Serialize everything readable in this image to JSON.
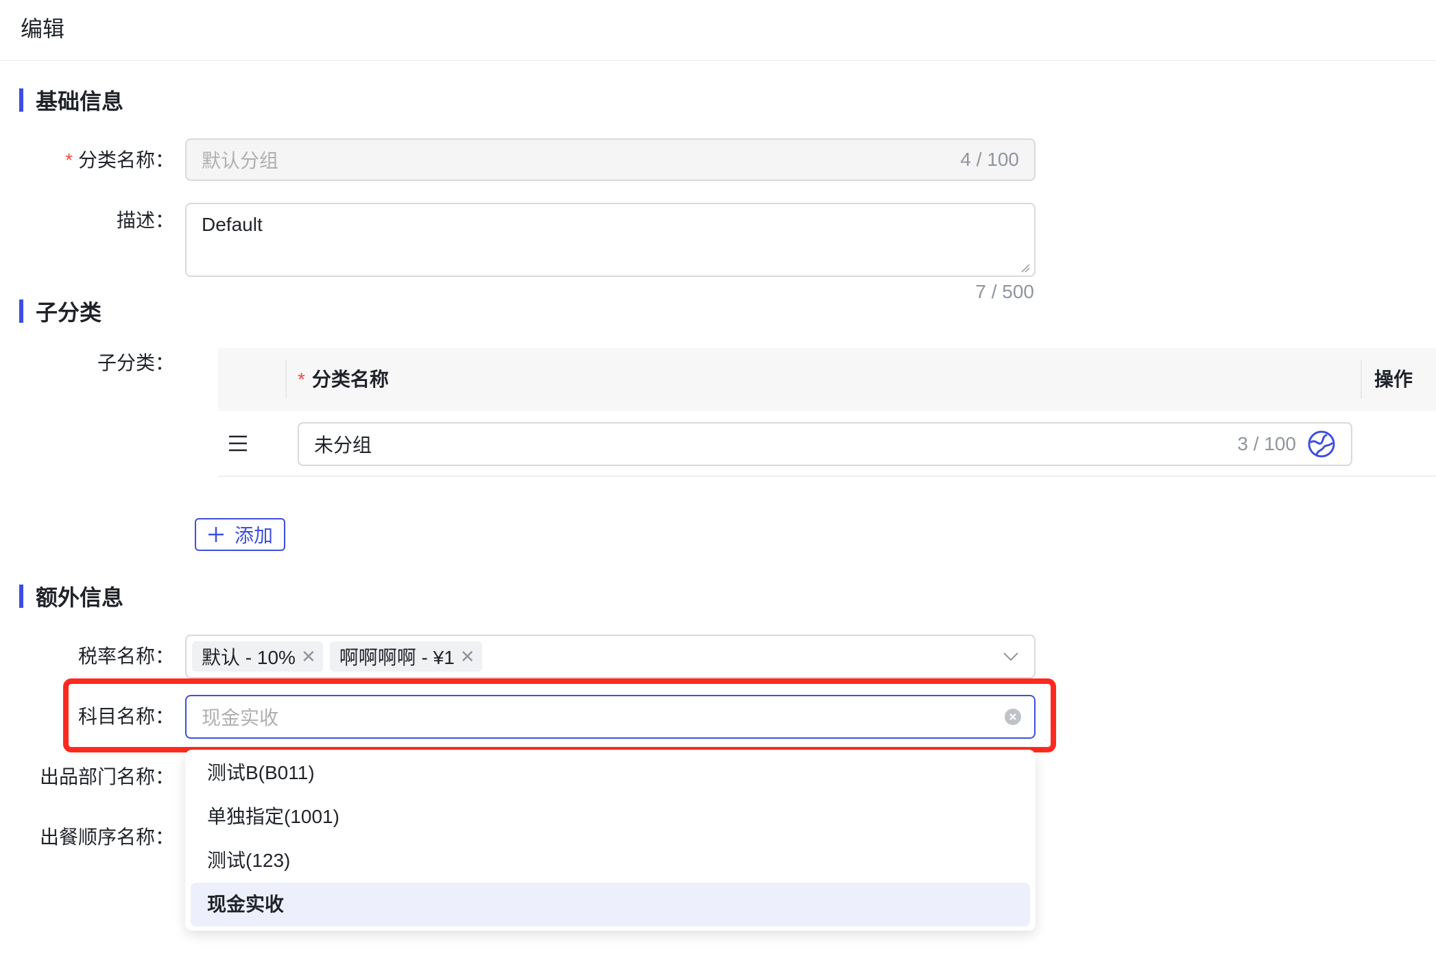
{
  "page": {
    "title": "编辑"
  },
  "basic": {
    "section_title": "基础信息",
    "name_label": "分类名称：",
    "name_value": "默认分组",
    "name_count": "4 / 100",
    "desc_label": "描述：",
    "desc_value": "Default",
    "desc_count": "7 / 500"
  },
  "sub": {
    "section_title": "子分类",
    "label": "子分类：",
    "col_name": "分类名称",
    "col_action": "操作",
    "rows": [
      {
        "name": "未分组",
        "count": "3 / 100"
      }
    ],
    "add_label": "添加"
  },
  "extra": {
    "section_title": "额外信息",
    "tax_label": "税率名称：",
    "tax_tags": [
      "默认 - 10%",
      "啊啊啊啊 - ¥1"
    ],
    "subject_label": "科目名称：",
    "subject_placeholder": "现金实收",
    "dept_label": "出品部门名称：",
    "order_label": "出餐顺序名称：",
    "options": [
      "测试B(B011)",
      "单独指定(1001)",
      "测试(123)",
      "现金实收"
    ],
    "selected_option": "现金实收"
  },
  "colors": {
    "accent": "#3d4ee0",
    "required": "#f54a45",
    "highlight": "#ff2a1f"
  }
}
